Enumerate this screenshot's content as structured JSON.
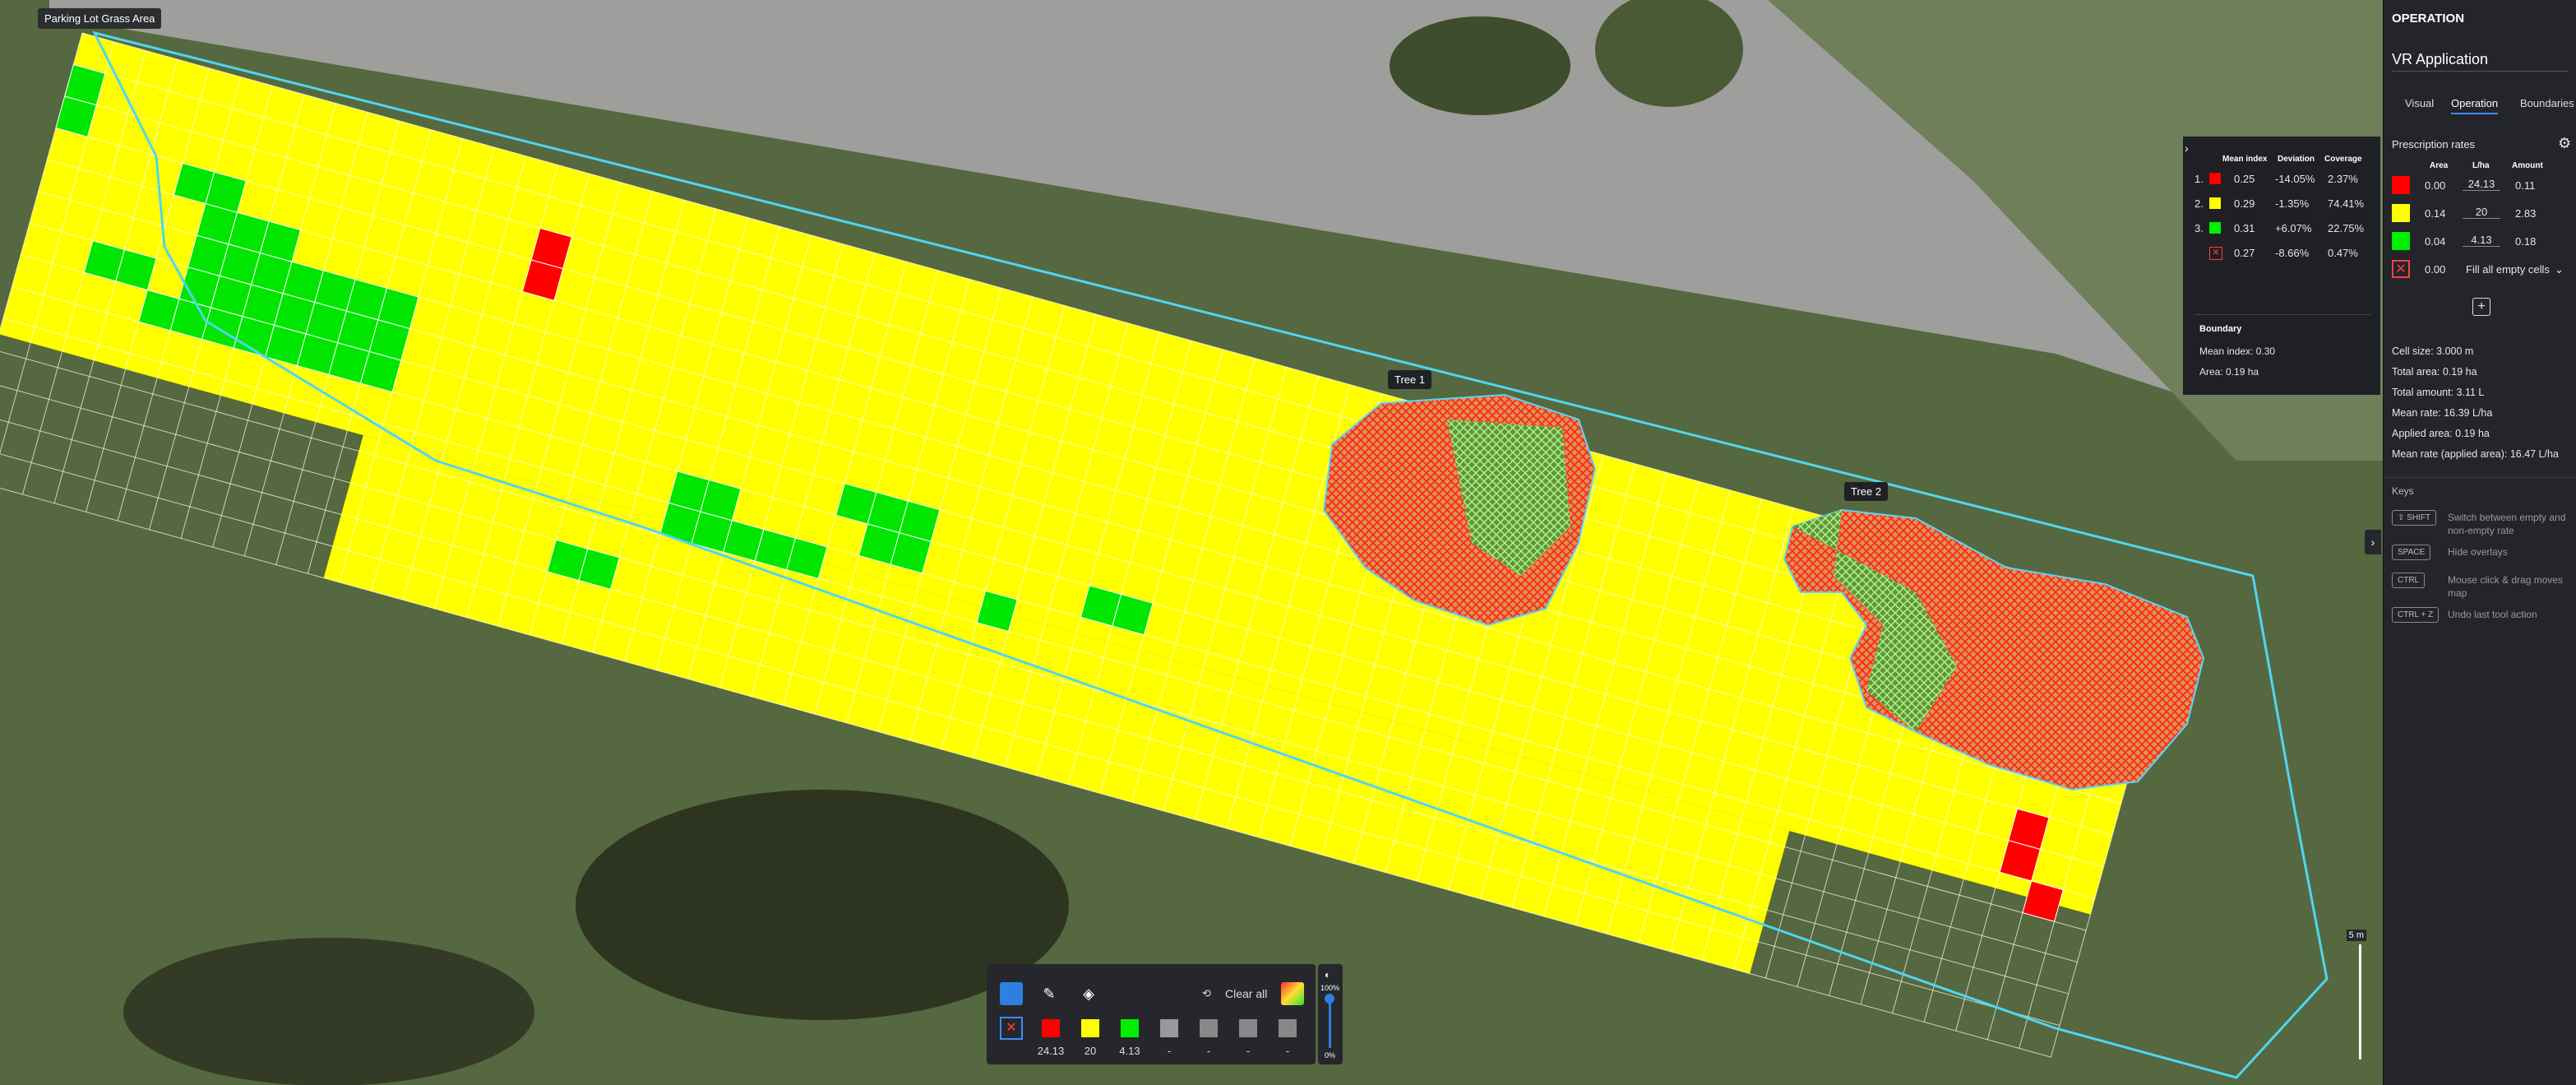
{
  "map": {
    "area_label": "Parking Lot Grass Area",
    "trees": [
      {
        "label": "Tree 1"
      },
      {
        "label": "Tree 2"
      }
    ],
    "scale_label": "5 m"
  },
  "stats": {
    "headers": [
      "Mean index",
      "Deviation",
      "Coverage"
    ],
    "rows": [
      {
        "num": "1.",
        "color": "#ff0000",
        "mean": "0.25",
        "deviation": "-14.05%",
        "coverage": "2.37%"
      },
      {
        "num": "2.",
        "color": "#ffff00",
        "mean": "0.29",
        "deviation": "-1.35%",
        "coverage": "74.41%"
      },
      {
        "num": "3.",
        "color": "#00ee00",
        "mean": "0.31",
        "deviation": "+6.07%",
        "coverage": "22.75%"
      },
      {
        "num": "",
        "color": "empty",
        "mean": "0.27",
        "deviation": "-8.66%",
        "coverage": "0.47%"
      }
    ],
    "boundary_title": "Boundary",
    "boundary_mean": "Mean index:  0.30",
    "boundary_area": "Area:  0.19  ha",
    "toggle_icon": "chevron-right-icon"
  },
  "panel": {
    "title": "OPERATION",
    "app_name": "VR Application",
    "tabs": [
      "Visual",
      "Operation",
      "Boundaries"
    ],
    "active_tab": "Operation",
    "prescription_title": "Prescription rates",
    "col_headers": [
      "Area",
      "L/ha",
      "Amount"
    ],
    "rates": [
      {
        "color": "#ff0000",
        "area": "0.00",
        "rate": "24.13",
        "amount": "0.11"
      },
      {
        "color": "#ffff00",
        "area": "0.14",
        "rate": "20",
        "amount": "2.83"
      },
      {
        "color": "#00ee00",
        "area": "0.04",
        "rate": "4.13",
        "amount": "0.18"
      },
      {
        "color": "empty",
        "area": "0.00",
        "rate": "Fill all empty cells",
        "amount": ""
      }
    ],
    "info": [
      "Cell size:  3.000  m",
      "Total area:  0.19  ha",
      "Total amount:  3.11  L",
      "Mean rate:  16.39  L/ha",
      "Applied area:  0.19  ha",
      "Mean rate (applied area):  16.47  L/ha"
    ],
    "keys_title": "Keys",
    "keys": [
      {
        "key": "⇧ SHIFT",
        "desc": "Switch between empty and non-empty rate"
      },
      {
        "key": "SPACE",
        "desc": "Hide overlays"
      },
      {
        "key": "CTRL",
        "desc": "Mouse click & drag moves map"
      },
      {
        "key": "CTRL + Z",
        "desc": "Undo last tool action"
      }
    ]
  },
  "toolbar": {
    "clear_all": "Clear all",
    "rate_labels": [
      "24.13",
      "20",
      "4.13",
      "-",
      "-",
      "-",
      "-"
    ],
    "opacity_top": "100%",
    "opacity_bottom": "0%"
  }
}
